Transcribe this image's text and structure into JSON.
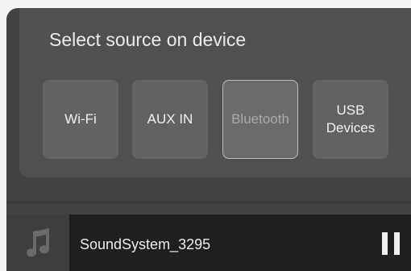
{
  "dialog": {
    "title": "Select source on device",
    "sources": [
      {
        "label": "Wi-Fi",
        "selected": false
      },
      {
        "label": "AUX IN",
        "selected": false
      },
      {
        "label": "Bluetooth",
        "selected": true
      },
      {
        "label": "USB\nDevices",
        "selected": false
      }
    ]
  },
  "now_playing": {
    "device_name": "SoundSystem_3295",
    "art_icon": "music-note-icon",
    "control_icon": "pause-icon"
  },
  "colors": {
    "screen_bg": "#434343",
    "dialog_bg": "#505050",
    "button_bg": "#626262",
    "selected_border": "#bcbcbc",
    "player_bar_bg": "#1f1f1f"
  }
}
